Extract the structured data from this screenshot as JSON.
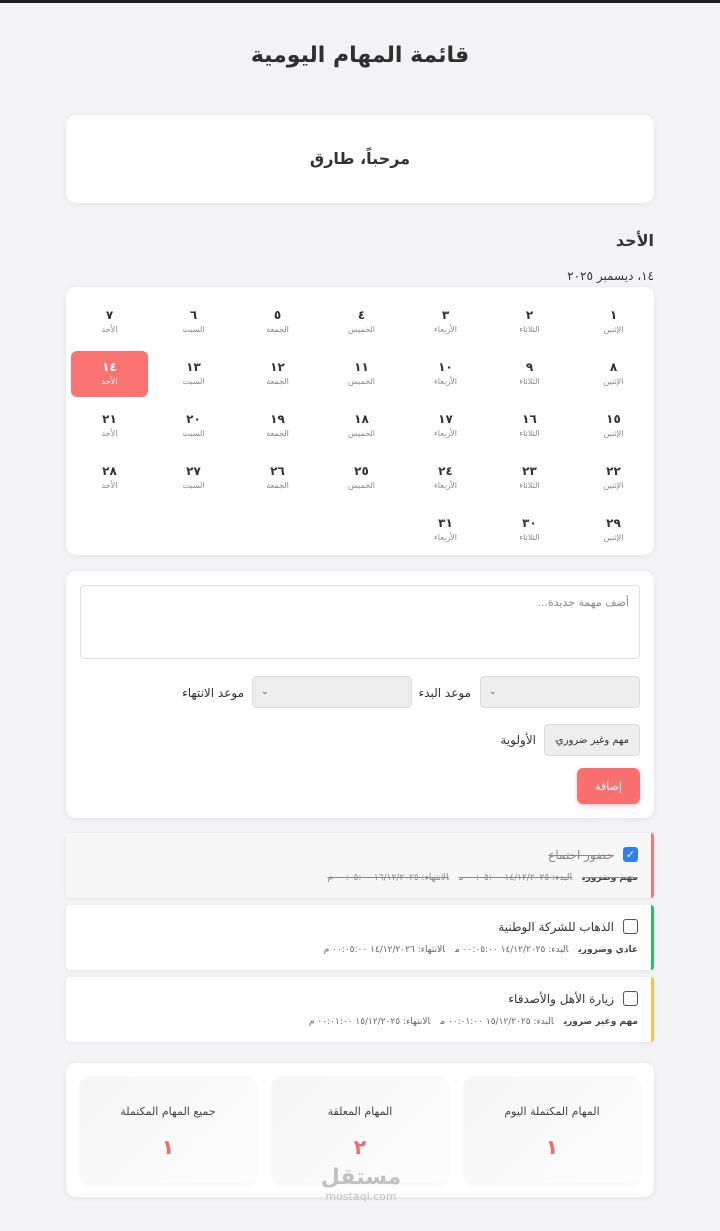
{
  "page": {
    "title": "قائمة المهام اليومية"
  },
  "welcome": {
    "text": "مرحباً، طارق"
  },
  "today": {
    "day_name": "الأحد",
    "date": "١٤، ديسمبر ٢٠٢٥"
  },
  "calendar": {
    "days": [
      {
        "num": "١",
        "wd": "الإثنين"
      },
      {
        "num": "٢",
        "wd": "الثلاثاء"
      },
      {
        "num": "٣",
        "wd": "الأربعاء"
      },
      {
        "num": "٤",
        "wd": "الخميس"
      },
      {
        "num": "٥",
        "wd": "الجمعة"
      },
      {
        "num": "٦",
        "wd": "السبت"
      },
      {
        "num": "٧",
        "wd": "الأحد"
      },
      {
        "num": "٨",
        "wd": "الإثنين"
      },
      {
        "num": "٩",
        "wd": "الثلاثاء"
      },
      {
        "num": "١٠",
        "wd": "الأربعاء"
      },
      {
        "num": "١١",
        "wd": "الخميس"
      },
      {
        "num": "١٢",
        "wd": "الجمعة"
      },
      {
        "num": "١٣",
        "wd": "السبت"
      },
      {
        "num": "١٤",
        "wd": "الأحد",
        "selected": true
      },
      {
        "num": "١٥",
        "wd": "الإثنين"
      },
      {
        "num": "١٦",
        "wd": "الثلاثاء"
      },
      {
        "num": "١٧",
        "wd": "الأربعاء"
      },
      {
        "num": "١٨",
        "wd": "الخميس"
      },
      {
        "num": "١٩",
        "wd": "الجمعة"
      },
      {
        "num": "٢٠",
        "wd": "السبت"
      },
      {
        "num": "٢١",
        "wd": "الأحد"
      },
      {
        "num": "٢٢",
        "wd": "الإثنين"
      },
      {
        "num": "٢٣",
        "wd": "الثلاثاء"
      },
      {
        "num": "٢٤",
        "wd": "الأربعاء"
      },
      {
        "num": "٢٥",
        "wd": "الخميس"
      },
      {
        "num": "٢٦",
        "wd": "الجمعة"
      },
      {
        "num": "٢٧",
        "wd": "السبت"
      },
      {
        "num": "٢٨",
        "wd": "الأحد"
      },
      {
        "num": "٢٩",
        "wd": "الإثنين"
      },
      {
        "num": "٣٠",
        "wd": "الثلاثاء"
      },
      {
        "num": "٣١",
        "wd": "الأربعاء"
      }
    ]
  },
  "form": {
    "placeholder": "أضف مهمة جديدة...",
    "start_label": "موعد البدء",
    "end_label": "موعد الانتهاء",
    "priority_label": "الأولوية",
    "priority_value": "مهم وغير ضروري",
    "add_label": "إضافة"
  },
  "tasks": [
    {
      "title": "حضور اجتماع",
      "priority": "مهم وضروري",
      "start": "البدء: ١٤/١٢/٢٠٢٥ ٠٠:٠٥:٠٠ م",
      "end": "الانتهاء: ١٦/١٢/٢٠٢٥ ٠٠:٠٥:٠٠ م",
      "done": true,
      "color": "#f07a7a"
    },
    {
      "title": "الذهاب للشركة الوطنية",
      "priority": "عادي وضروري",
      "start": "البدء: ١٤/١٢/٢٠٢٥ ٠٠:٠٥:٠٠ م",
      "end": "الانتهاء: ١٤/١٢/٢٠٢٦ ٠٠:٠٥:٠٠ م",
      "done": false,
      "color": "#2ebd5f"
    },
    {
      "title": "زيارة الأهل والأصدقاء",
      "priority": "مهم وغير ضروري",
      "start": "البدء: ١٥/١٢/٢٠٢٥ ٠٠:٠١:٠٠ م",
      "end": "الانتهاء: ١٥/١٢/٢٠٢٥ ٠٠:٠١:٠٠ م",
      "done": false,
      "color": "#f3c34a"
    }
  ],
  "stats": [
    {
      "label": "المهام المكتملة اليوم",
      "value": "١"
    },
    {
      "label": "المهام المعلقة",
      "value": "٢"
    },
    {
      "label": "جميع المهام المكتملة",
      "value": "١"
    }
  ],
  "watermark": {
    "ar": "مستقل",
    "en": "mostaql.com"
  }
}
